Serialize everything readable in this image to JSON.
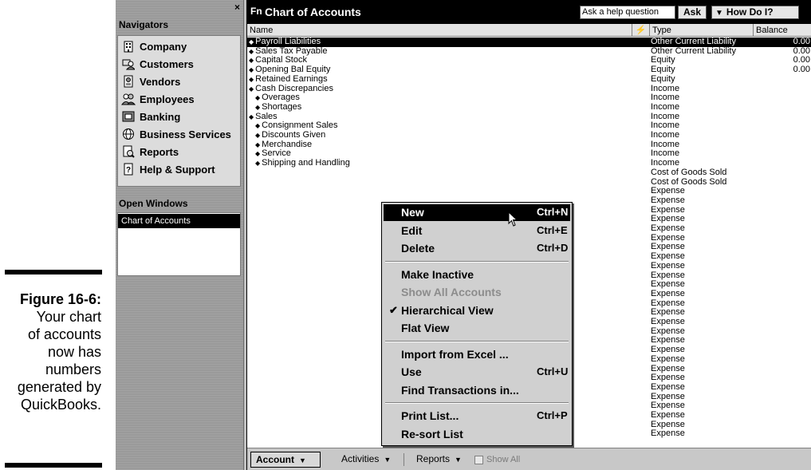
{
  "figure": {
    "label": "Figure 16-6:",
    "text": "Your chart\nof accounts\nnow has\nnumbers\ngenerated by\nQuickBooks."
  },
  "navigators": {
    "close": "×",
    "heading": "Navigators",
    "items": [
      {
        "label": "Company",
        "icon": "company-icon"
      },
      {
        "label": "Customers",
        "icon": "customers-icon"
      },
      {
        "label": "Vendors",
        "icon": "vendors-icon"
      },
      {
        "label": "Employees",
        "icon": "employees-icon"
      },
      {
        "label": "Banking",
        "icon": "banking-icon"
      },
      {
        "label": "Business Services",
        "icon": "business-services-icon"
      },
      {
        "label": "Reports",
        "icon": "reports-icon"
      },
      {
        "label": "Help & Support",
        "icon": "help-support-icon"
      }
    ],
    "open_windows_heading": "Open Windows",
    "open_windows": [
      "Chart of Accounts"
    ]
  },
  "window": {
    "icon_text": "Fn",
    "title": "Chart of Accounts",
    "help_placeholder": "Ask a help question",
    "ask_label": "Ask",
    "how_do_label": "How Do I?"
  },
  "columns": {
    "name": "Name",
    "flag": "⚡",
    "type": "Type",
    "balance": "Balance"
  },
  "accounts": [
    {
      "name": "Payroll Liabilities",
      "indent": 0,
      "type": "Other Current Liability",
      "balance": "0.00",
      "selected": true
    },
    {
      "name": "Sales Tax Payable",
      "indent": 0,
      "type": "Other Current Liability",
      "balance": "0.00"
    },
    {
      "name": "Capital Stock",
      "indent": 0,
      "type": "Equity",
      "balance": "0.00"
    },
    {
      "name": "Opening Bal Equity",
      "indent": 0,
      "type": "Equity",
      "balance": "0.00"
    },
    {
      "name": "Retained Earnings",
      "indent": 0,
      "type": "Equity",
      "balance": ""
    },
    {
      "name": "Cash Discrepancies",
      "indent": 0,
      "type": "Income",
      "balance": ""
    },
    {
      "name": "Overages",
      "indent": 1,
      "type": "Income",
      "balance": ""
    },
    {
      "name": "Shortages",
      "indent": 1,
      "type": "Income",
      "balance": ""
    },
    {
      "name": "Sales",
      "indent": 0,
      "type": "Income",
      "balance": ""
    },
    {
      "name": "Consignment Sales",
      "indent": 1,
      "type": "Income",
      "balance": ""
    },
    {
      "name": "Discounts Given",
      "indent": 1,
      "type": "Income",
      "balance": ""
    },
    {
      "name": "Merchandise",
      "indent": 1,
      "type": "Income",
      "balance": ""
    },
    {
      "name": "Service",
      "indent": 1,
      "type": "Income",
      "balance": ""
    },
    {
      "name": "Shipping and Handling",
      "indent": 1,
      "type": "Income",
      "balance": ""
    },
    {
      "name": "",
      "indent": 0,
      "type": "Cost of Goods Sold",
      "balance": ""
    },
    {
      "name": "",
      "indent": 0,
      "type": "Cost of Goods Sold",
      "balance": ""
    },
    {
      "name": "",
      "indent": 0,
      "type": "Expense",
      "balance": ""
    },
    {
      "name": "",
      "indent": 0,
      "type": "Expense",
      "balance": ""
    },
    {
      "name": "",
      "indent": 0,
      "type": "Expense",
      "balance": ""
    },
    {
      "name": "",
      "indent": 0,
      "type": "Expense",
      "balance": ""
    },
    {
      "name": "",
      "indent": 0,
      "type": "Expense",
      "balance": ""
    },
    {
      "name": "",
      "indent": 0,
      "type": "Expense",
      "balance": ""
    },
    {
      "name": "",
      "indent": 0,
      "type": "Expense",
      "balance": ""
    },
    {
      "name": "",
      "indent": 0,
      "type": "Expense",
      "balance": ""
    },
    {
      "name": "",
      "indent": 0,
      "type": "Expense",
      "balance": ""
    },
    {
      "name": "",
      "indent": 0,
      "type": "Expense",
      "balance": ""
    },
    {
      "name": "",
      "indent": 0,
      "type": "Expense",
      "balance": ""
    },
    {
      "name": "",
      "indent": 0,
      "type": "Expense",
      "balance": ""
    },
    {
      "name": "",
      "indent": 0,
      "type": "Expense",
      "balance": ""
    },
    {
      "name": "",
      "indent": 0,
      "type": "Expense",
      "balance": ""
    },
    {
      "name": "",
      "indent": 0,
      "type": "Expense",
      "balance": ""
    },
    {
      "name": "",
      "indent": 0,
      "type": "Expense",
      "balance": ""
    },
    {
      "name": "",
      "indent": 0,
      "type": "Expense",
      "balance": ""
    },
    {
      "name": "",
      "indent": 0,
      "type": "Expense",
      "balance": ""
    },
    {
      "name": "",
      "indent": 0,
      "type": "Expense",
      "balance": ""
    },
    {
      "name": "",
      "indent": 0,
      "type": "Expense",
      "balance": ""
    },
    {
      "name": "",
      "indent": 0,
      "type": "Expense",
      "balance": ""
    },
    {
      "name": "",
      "indent": 0,
      "type": "Expense",
      "balance": ""
    },
    {
      "name": "",
      "indent": 0,
      "type": "Expense",
      "balance": ""
    },
    {
      "name": "",
      "indent": 0,
      "type": "Expense",
      "balance": ""
    },
    {
      "name": "",
      "indent": 0,
      "type": "Expense",
      "balance": ""
    },
    {
      "name": "",
      "indent": 0,
      "type": "Expense",
      "balance": ""
    },
    {
      "name": "",
      "indent": 0,
      "type": "Expense",
      "balance": ""
    }
  ],
  "menu": {
    "items": [
      {
        "id": "new",
        "label": "New",
        "shortcut": "Ctrl+N",
        "highlighted": true
      },
      {
        "id": "edit",
        "label": "Edit",
        "shortcut": "Ctrl+E"
      },
      {
        "id": "delete",
        "label": "Delete",
        "shortcut": "Ctrl+D"
      },
      {
        "id": "sep1",
        "separator": true
      },
      {
        "id": "make-inactive",
        "label": "Make  Inactive",
        "shortcut": ""
      },
      {
        "id": "show-all-accounts",
        "label": "Show All Accounts",
        "shortcut": "",
        "disabled": true
      },
      {
        "id": "hierarchical-view",
        "label": "Hierarchical View",
        "shortcut": "",
        "checked": true
      },
      {
        "id": "flat-view",
        "label": "Flat View",
        "shortcut": ""
      },
      {
        "id": "sep2",
        "separator": true
      },
      {
        "id": "import-from-excel",
        "label": "Import from Excel ...",
        "shortcut": ""
      },
      {
        "id": "use",
        "label": "Use",
        "shortcut": "Ctrl+U"
      },
      {
        "id": "find-transactions",
        "label": "Find Transactions in...",
        "shortcut": ""
      },
      {
        "id": "sep3",
        "separator": true
      },
      {
        "id": "print-list",
        "label": "Print List...",
        "shortcut": "Ctrl+P"
      },
      {
        "id": "re-sort-list",
        "label": "Re-sort List",
        "shortcut": ""
      }
    ],
    "check_mark": "✔"
  },
  "buttonbar": {
    "account_label": "Account",
    "activities_label": "Activities",
    "reports_label": "Reports",
    "dropdown_arrow": "▼",
    "show_all_label": "Show All"
  },
  "colors": {
    "selection": "#000000",
    "panel_bg": "#9a9a9a",
    "menu_bg": "#d0d0d0"
  }
}
